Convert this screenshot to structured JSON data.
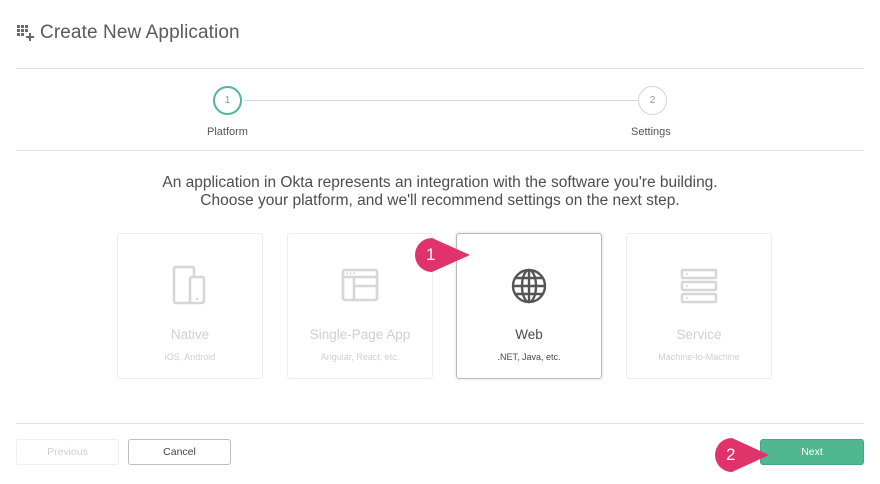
{
  "header": {
    "title": "Create New Application",
    "icon": "grid-plus-icon"
  },
  "stepper": {
    "steps": [
      {
        "number": "1",
        "label": "Platform",
        "active": true
      },
      {
        "number": "2",
        "label": "Settings",
        "active": false
      }
    ],
    "active_color": "#4fb896"
  },
  "intro": {
    "line1": "An application in Okta represents an integration with the software you're building.",
    "line2": "Choose your platform, and we'll recommend settings on the next step."
  },
  "platforms": [
    {
      "name": "Native",
      "sub": "iOS, Android",
      "icon": "mobile-devices-icon",
      "selected": false
    },
    {
      "name": "Single-Page App",
      "sub": "Angular, React, etc.",
      "icon": "browser-window-icon",
      "selected": false
    },
    {
      "name": "Web",
      "sub": ".NET, Java, etc.",
      "icon": "globe-icon",
      "selected": true
    },
    {
      "name": "Service",
      "sub": "Machine-to-Machine",
      "icon": "server-stack-icon",
      "selected": false
    }
  ],
  "footer": {
    "previous_label": "Previous",
    "cancel_label": "Cancel",
    "next_label": "Next",
    "next_color": "#50b791"
  },
  "annotations": [
    {
      "number": "1",
      "color": "#e0336b"
    },
    {
      "number": "2",
      "color": "#e0336b"
    }
  ]
}
